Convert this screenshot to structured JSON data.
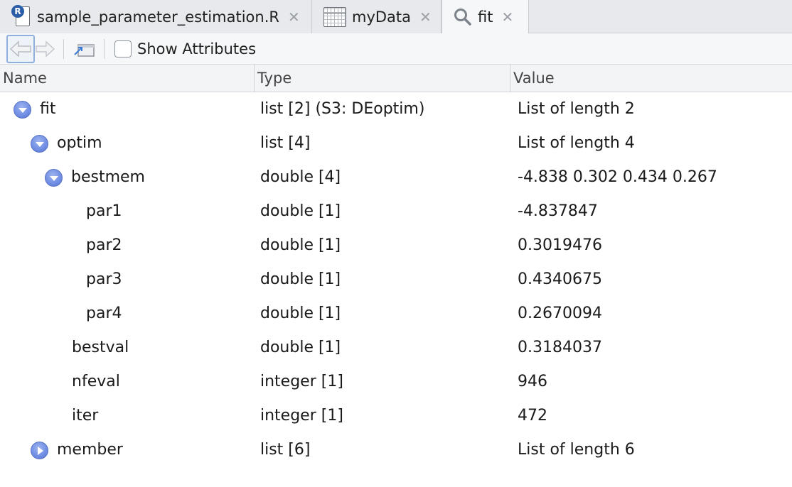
{
  "tabs": [
    {
      "label": "sample_parameter_estimation.R",
      "icon": "r-file-icon",
      "active": false
    },
    {
      "label": "myData",
      "icon": "data-grid-icon",
      "active": false
    },
    {
      "label": "fit",
      "icon": "search-icon",
      "active": true
    }
  ],
  "toolbar": {
    "show_attributes_label": "Show Attributes",
    "show_attributes_checked": false
  },
  "columns": {
    "name": "Name",
    "type": "Type",
    "value": "Value"
  },
  "rows": [
    {
      "name": "fit",
      "type": "list [2] (S3: DEoptim)",
      "value": "List of length 2",
      "depth": 0,
      "toggle": "expanded"
    },
    {
      "name": "optim",
      "type": "list [4]",
      "value": "List of length 4",
      "depth": 1,
      "toggle": "expanded"
    },
    {
      "name": "bestmem",
      "type": "double [4]",
      "value": "-4.838 0.302 0.434 0.267",
      "depth": 2,
      "toggle": "expanded"
    },
    {
      "name": "par1",
      "type": "double [1]",
      "value": "-4.837847",
      "depth": 3,
      "toggle": "none"
    },
    {
      "name": "par2",
      "type": "double [1]",
      "value": "0.3019476",
      "depth": 3,
      "toggle": "none"
    },
    {
      "name": "par3",
      "type": "double [1]",
      "value": "0.4340675",
      "depth": 3,
      "toggle": "none"
    },
    {
      "name": "par4",
      "type": "double [1]",
      "value": "0.2670094",
      "depth": 3,
      "toggle": "none"
    },
    {
      "name": "bestval",
      "type": "double [1]",
      "value": "0.3184037",
      "depth": 2,
      "toggle": "none"
    },
    {
      "name": "nfeval",
      "type": "integer [1]",
      "value": "946",
      "depth": 2,
      "toggle": "none"
    },
    {
      "name": "iter",
      "type": "integer [1]",
      "value": "472",
      "depth": 2,
      "toggle": "none"
    },
    {
      "name": "member",
      "type": "list [6]",
      "value": "List of length 6",
      "depth": 1,
      "toggle": "collapsed"
    }
  ],
  "colors": {
    "toggle_blue": "#6f8de3",
    "tabbar_bg": "#e7e9ec",
    "active_tab_bg": "#f6f7f8"
  }
}
